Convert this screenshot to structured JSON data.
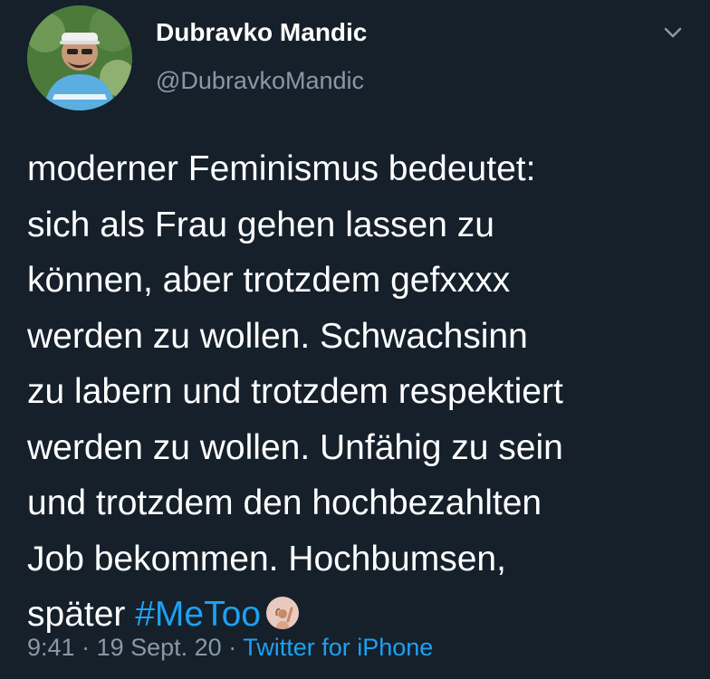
{
  "user": {
    "display_name": "Dubravko Mandic",
    "handle": "@DubravkoMandic"
  },
  "icons": {
    "menu": "chevron-down-icon",
    "emoji": "woman-hand-raised-emoji"
  },
  "tweet": {
    "lines": [
      "moderner Feminismus bedeutet:",
      "sich als Frau gehen lassen zu",
      "können, aber trotzdem gefxxxx",
      "werden zu wollen. Schwachsinn",
      "zu labern und trotzdem respektiert",
      "werden zu wollen. Unfähig zu sein",
      "und trotzdem den hochbezahlten",
      "Job bekommen. Hochbumsen,"
    ],
    "last_line_text": "später ",
    "hashtag": "#MeToo"
  },
  "meta": {
    "time": "9:41",
    "sep1": " · ",
    "date": "19 Sept. 20",
    "sep2": " · ",
    "source": "Twitter for iPhone"
  },
  "colors": {
    "background": "#15202b",
    "text": "#ffffff",
    "secondary": "#8899a6",
    "accent": "#1da1f2"
  }
}
